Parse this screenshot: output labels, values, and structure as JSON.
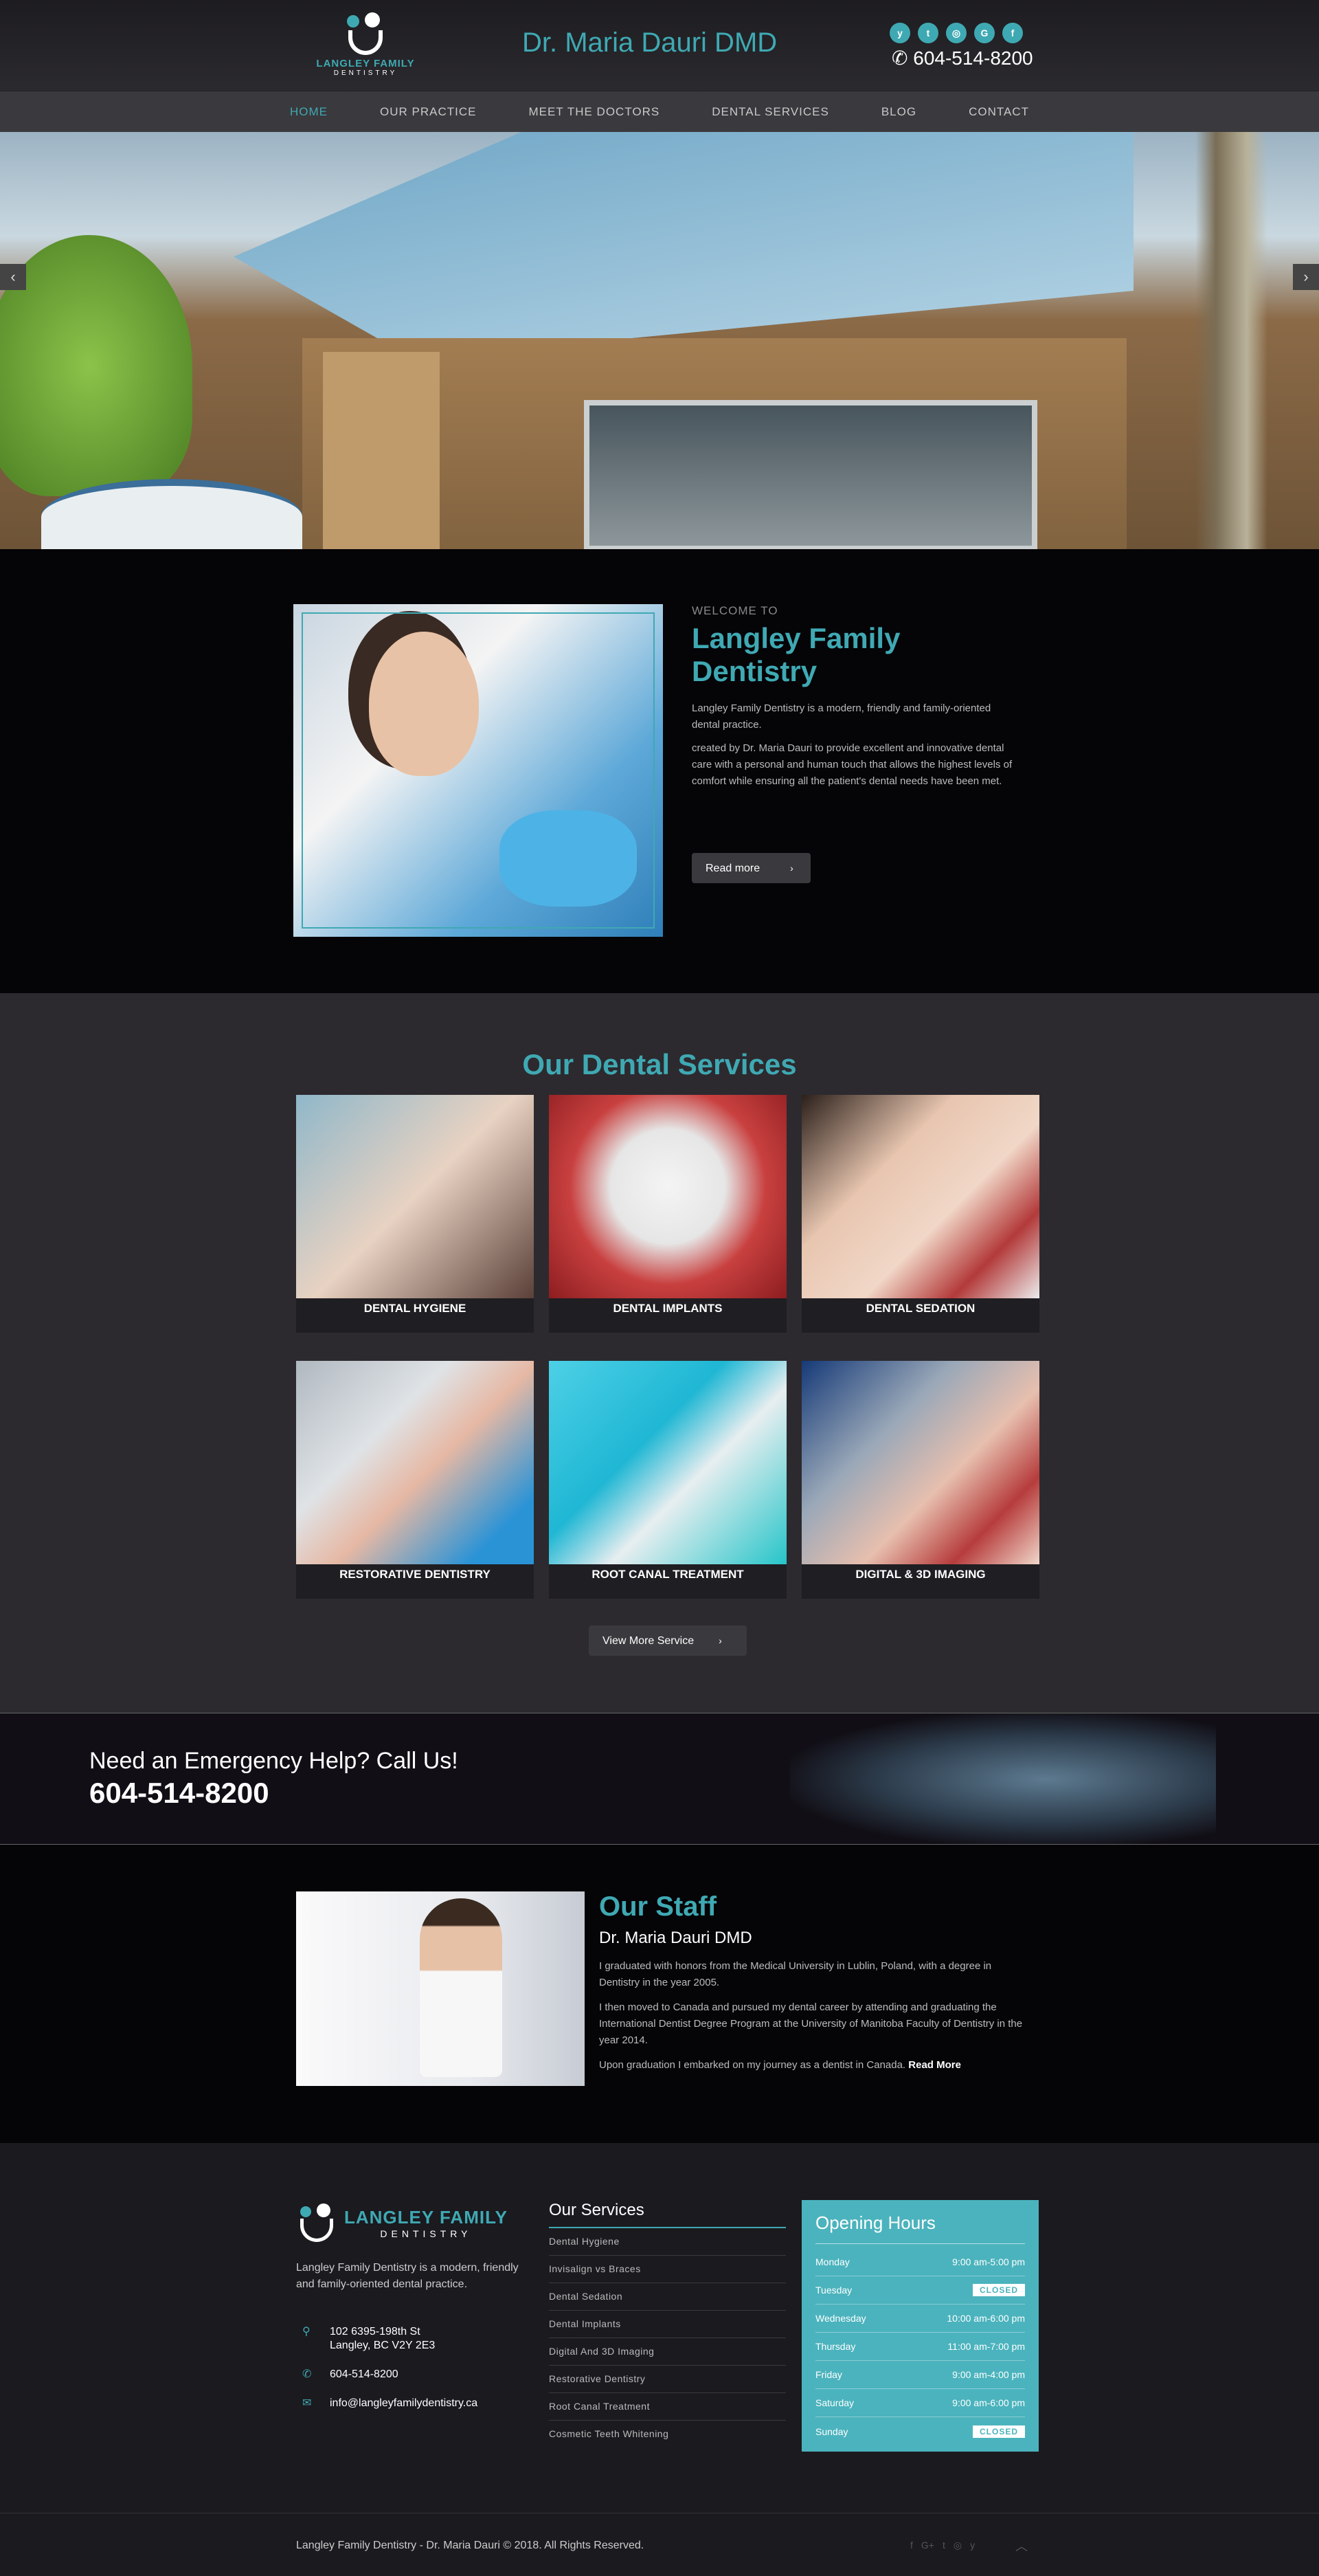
{
  "header": {
    "logo_line1": "LANGLEY FAMILY",
    "logo_line2": "DENTISTRY",
    "title": "Dr. Maria Dauri DMD",
    "phone": "604-514-8200",
    "social_icons": [
      "yelp-icon",
      "twitter-icon",
      "instagram-icon",
      "google-plus-icon",
      "facebook-icon"
    ]
  },
  "nav": {
    "items": [
      "HOME",
      "OUR PRACTICE",
      "MEET THE DOCTORS",
      "DENTAL SERVICES",
      "BLOG",
      "CONTACT"
    ],
    "active": "HOME"
  },
  "hero": {
    "prev": "‹",
    "next": "›"
  },
  "welcome": {
    "kicker": "WELCOME TO",
    "heading": "Langley Family Dentistry",
    "p1": "Langley Family Dentistry is a modern, friendly and family-oriented dental practice.",
    "p2": "created by Dr. Maria Dauri to provide excellent and innovative dental care with a personal and human touch that allows the highest levels of comfort while ensuring all the patient's dental needs have been met.",
    "button": "Read more"
  },
  "services": {
    "heading": "Our Dental Services",
    "items": [
      "DENTAL HYGIENE",
      "DENTAL IMPLANTS",
      "DENTAL SEDATION",
      "RESTORATIVE DENTISTRY",
      "ROOT CANAL TREATMENT",
      "DIGITAL & 3D IMAGING"
    ],
    "button": "View More Service"
  },
  "emergency": {
    "question": "Need an Emergency Help? Call Us!",
    "phone": "604-514-8200"
  },
  "staff": {
    "heading": "Our Staff",
    "name": "Dr. Maria Dauri DMD",
    "p1": "I graduated with honors from the Medical University in Lublin, Poland, with a degree in Dentistry in the year 2005.",
    "p2": "I then moved to Canada and pursued my dental career by attending and graduating the International Dentist Degree Program at the University of Manitoba Faculty of Dentistry in the year 2014.",
    "p3": "Upon graduation I embarked on my journey as a dentist in Canada.",
    "read_more": "Read More"
  },
  "footer": {
    "logo_line1": "LANGLEY FAMILY",
    "logo_line2": "DENTISTRY",
    "about": "Langley Family Dentistry is a modern, friendly and family-oriented dental practice.",
    "address1": "102 6395-198th St",
    "address2": "Langley, BC V2Y 2E3",
    "phone": "604-514-8200",
    "email": "info@langleyfamilydentistry.ca",
    "services_heading": "Our Services",
    "services": [
      "Dental Hygiene",
      "Invisalign vs Braces",
      "Dental Sedation",
      "Dental Implants",
      "Digital And 3D Imaging",
      "Restorative Dentistry",
      "Root Canal Treatment",
      "Cosmetic Teeth Whitening"
    ],
    "hours_heading": "Opening Hours",
    "hours": [
      {
        "day": "Monday",
        "time": "9:00 am-5:00 pm"
      },
      {
        "day": "Tuesday",
        "time": "CLOSED"
      },
      {
        "day": "Wednesday",
        "time": "10:00 am-6:00 pm"
      },
      {
        "day": "Thursday",
        "time": "11:00 am-7:00 pm"
      },
      {
        "day": "Friday",
        "time": "9:00 am-4:00 pm"
      },
      {
        "day": "Saturday",
        "time": "9:00 am-6:00 pm"
      },
      {
        "day": "Sunday",
        "time": "CLOSED"
      }
    ],
    "copyright": "Langley Family Dentistry - Dr. Maria Dauri © 2018. All Rights Reserved."
  },
  "colors": {
    "accent": "#3fa9b3",
    "hours_bg": "#4bb3bd"
  }
}
